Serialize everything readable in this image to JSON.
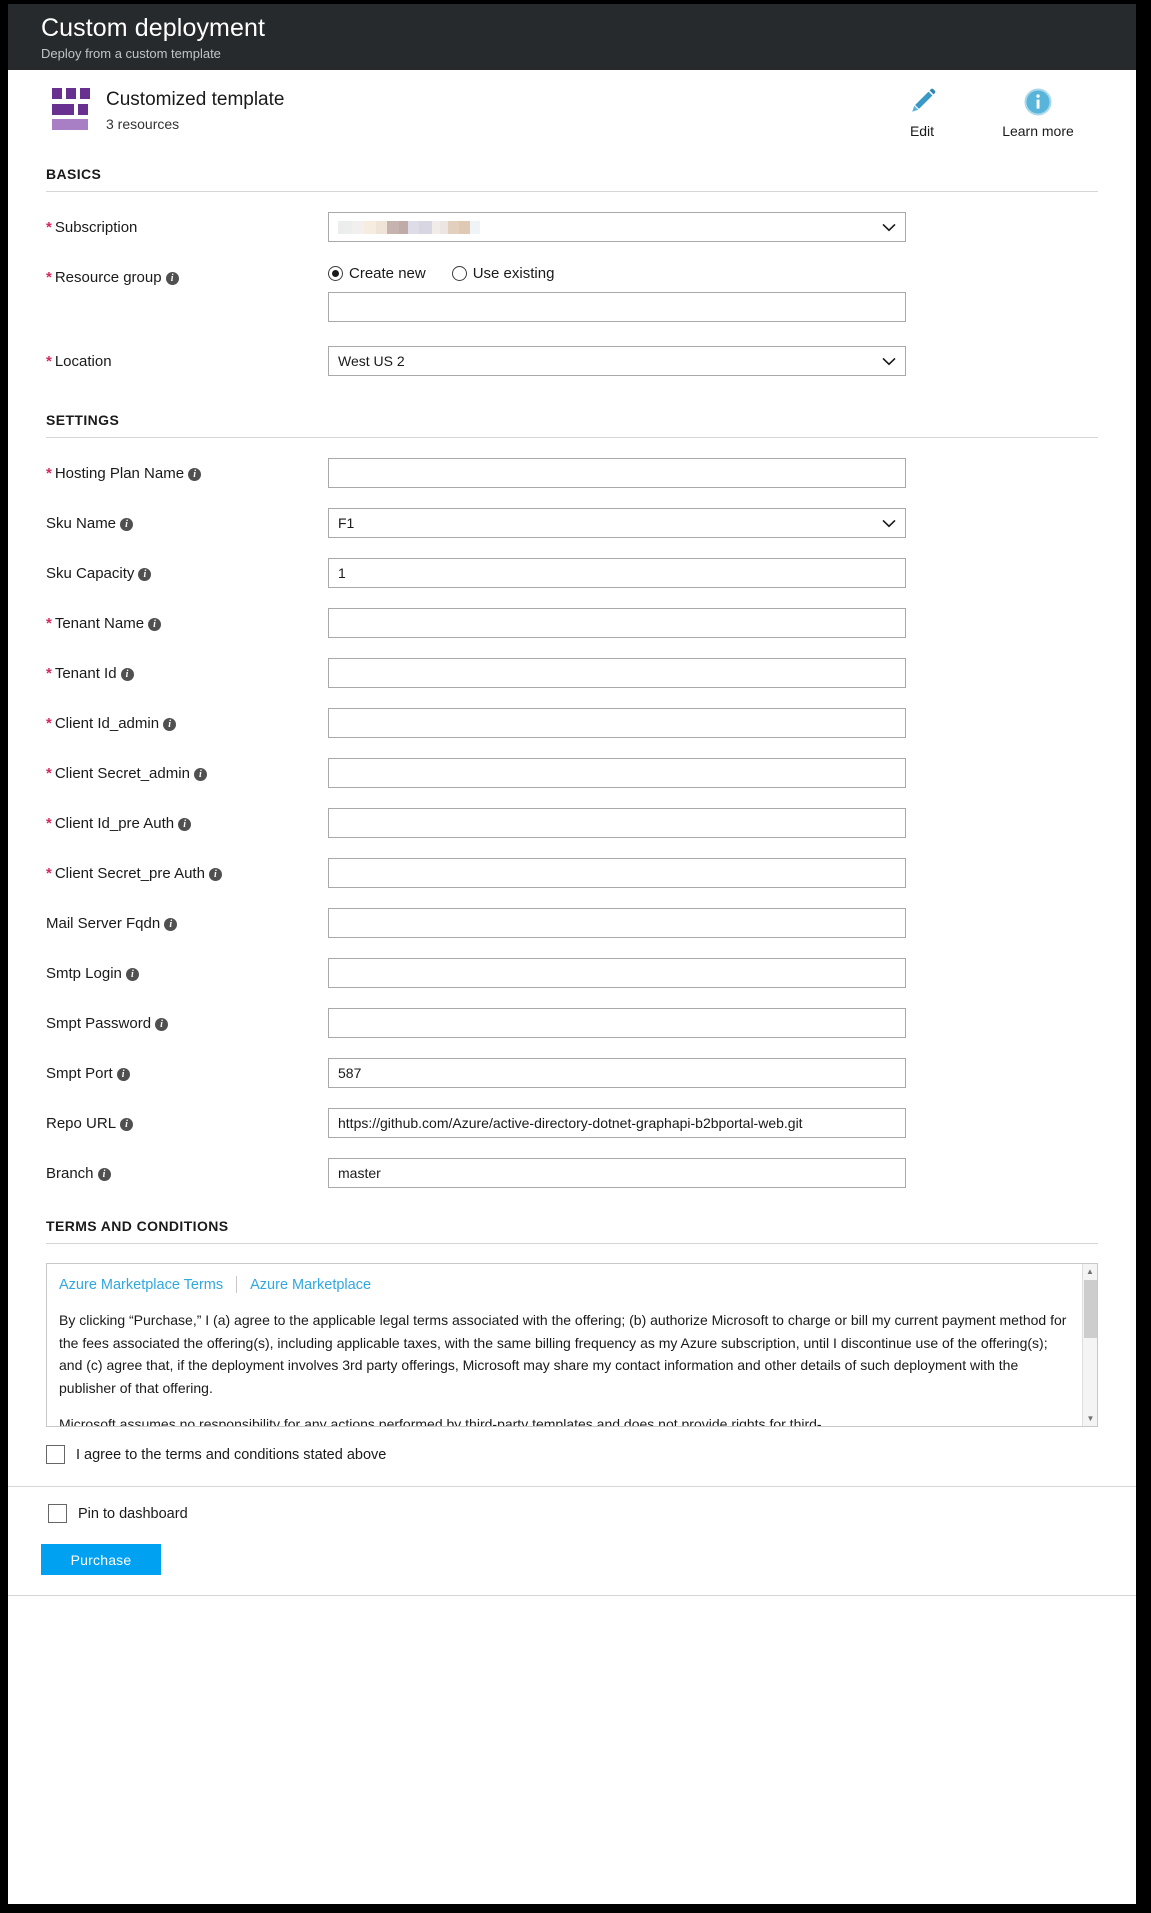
{
  "header": {
    "title": "Custom deployment",
    "subtitle": "Deploy from a custom template"
  },
  "template_bar": {
    "name": "Customized template",
    "resources": "3 resources",
    "actions": [
      {
        "label": "Edit",
        "icon": "pencil-icon"
      },
      {
        "label": "Learn more",
        "icon": "info-circle-icon"
      }
    ]
  },
  "basics": {
    "section_label": "BASICS",
    "subscription": {
      "label": "Subscription",
      "required": true,
      "value": "",
      "redacted": true,
      "redacted_blocks": [
        "#eceded",
        "#ececec",
        "#f5ece2",
        "#f3e6da",
        "#c8b6b3",
        "#beaaa6",
        "#dedce6",
        "#d9d7e3",
        "#f2ecea",
        "#efe8e4",
        "#e6d2c0",
        "#ddc7b2",
        "#f1f5f7"
      ]
    },
    "resource_group": {
      "label": "Resource group",
      "required": true,
      "has_info": true,
      "options": [
        {
          "label": "Create new",
          "selected": true
        },
        {
          "label": "Use existing",
          "selected": false
        }
      ],
      "value": ""
    },
    "location": {
      "label": "Location",
      "required": true,
      "value": "West US 2"
    }
  },
  "settings": {
    "section_label": "SETTINGS",
    "fields": [
      {
        "label": "Hosting Plan Name",
        "required": true,
        "has_info": true,
        "type": "text",
        "value": ""
      },
      {
        "label": "Sku Name",
        "required": false,
        "has_info": true,
        "type": "select",
        "value": "F1"
      },
      {
        "label": "Sku Capacity",
        "required": false,
        "has_info": true,
        "type": "text",
        "value": "1"
      },
      {
        "label": "Tenant Name",
        "required": true,
        "has_info": true,
        "type": "text",
        "value": ""
      },
      {
        "label": "Tenant Id",
        "required": true,
        "has_info": true,
        "type": "text",
        "value": ""
      },
      {
        "label": "Client Id_admin",
        "required": true,
        "has_info": true,
        "type": "text",
        "value": ""
      },
      {
        "label": "Client Secret_admin",
        "required": true,
        "has_info": true,
        "type": "text",
        "value": ""
      },
      {
        "label": "Client Id_pre Auth",
        "required": true,
        "has_info": true,
        "type": "text",
        "value": ""
      },
      {
        "label": "Client Secret_pre Auth",
        "required": true,
        "has_info": true,
        "type": "text",
        "value": ""
      },
      {
        "label": "Mail Server Fqdn",
        "required": false,
        "has_info": true,
        "type": "text",
        "value": ""
      },
      {
        "label": "Smtp Login",
        "required": false,
        "has_info": true,
        "type": "text",
        "value": ""
      },
      {
        "label": "Smpt Password",
        "required": false,
        "has_info": true,
        "type": "text",
        "value": ""
      },
      {
        "label": "Smpt Port",
        "required": false,
        "has_info": true,
        "type": "text",
        "value": "587"
      },
      {
        "label": "Repo URL",
        "required": false,
        "has_info": true,
        "type": "text",
        "value": "https://github.com/Azure/active-directory-dotnet-graphapi-b2bportal-web.git"
      },
      {
        "label": "Branch",
        "required": false,
        "has_info": true,
        "type": "text",
        "value": "master"
      }
    ]
  },
  "terms": {
    "section_label": "TERMS AND CONDITIONS",
    "links": [
      {
        "label": "Azure Marketplace Terms"
      },
      {
        "label": "Azure Marketplace"
      }
    ],
    "paragraph_1": "By clicking “Purchase,” I (a) agree to the applicable legal terms associated with the offering; (b) authorize Microsoft to charge or bill my current payment method for the fees associated the offering(s), including applicable taxes, with the same billing frequency as my Azure subscription, until I discontinue use of the offering(s); and (c) agree that, if the deployment involves 3rd party offerings, Microsoft may share my contact information and other details of such deployment with the publisher of that offering.",
    "paragraph_2": "Microsoft assumes no responsibility for any actions performed by third-party templates and does not provide rights for third-",
    "agree_label": "I agree to the terms and conditions stated above",
    "agree_checked": false
  },
  "footer": {
    "pin_label": "Pin to dashboard",
    "pin_checked": false,
    "purchase_label": "Purchase"
  },
  "colors": {
    "header_bg": "#262a2d",
    "accent_blue": "#00a1f1",
    "link_blue": "#31a7e0",
    "required_red": "#d6285a",
    "template_purple": "#68308f"
  }
}
